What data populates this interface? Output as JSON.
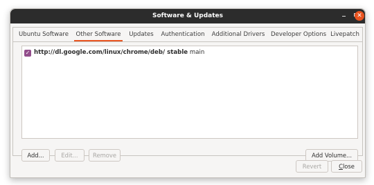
{
  "window": {
    "title": "Software & Updates"
  },
  "tabs": [
    {
      "label": "Ubuntu Software"
    },
    {
      "label": "Other Software"
    },
    {
      "label": "Updates"
    },
    {
      "label": "Authentication"
    },
    {
      "label": "Additional Drivers"
    },
    {
      "label": "Developer Options"
    },
    {
      "label": "Livepatch"
    }
  ],
  "active_tab": "Other Software",
  "sources": [
    {
      "checked": true,
      "url": "http://dl.google.com/linux/chrome/deb/ stable",
      "component": "main"
    }
  ],
  "list_buttons": {
    "add": "Add...",
    "edit": "Edit...",
    "remove": "Remove",
    "add_volume": "Add Volume..."
  },
  "dialog_buttons": {
    "revert": "Revert",
    "close": "Close"
  },
  "colors": {
    "accent": "#e95420",
    "checkbox": "#924d8b",
    "titlebar": "#2c2c2c"
  }
}
